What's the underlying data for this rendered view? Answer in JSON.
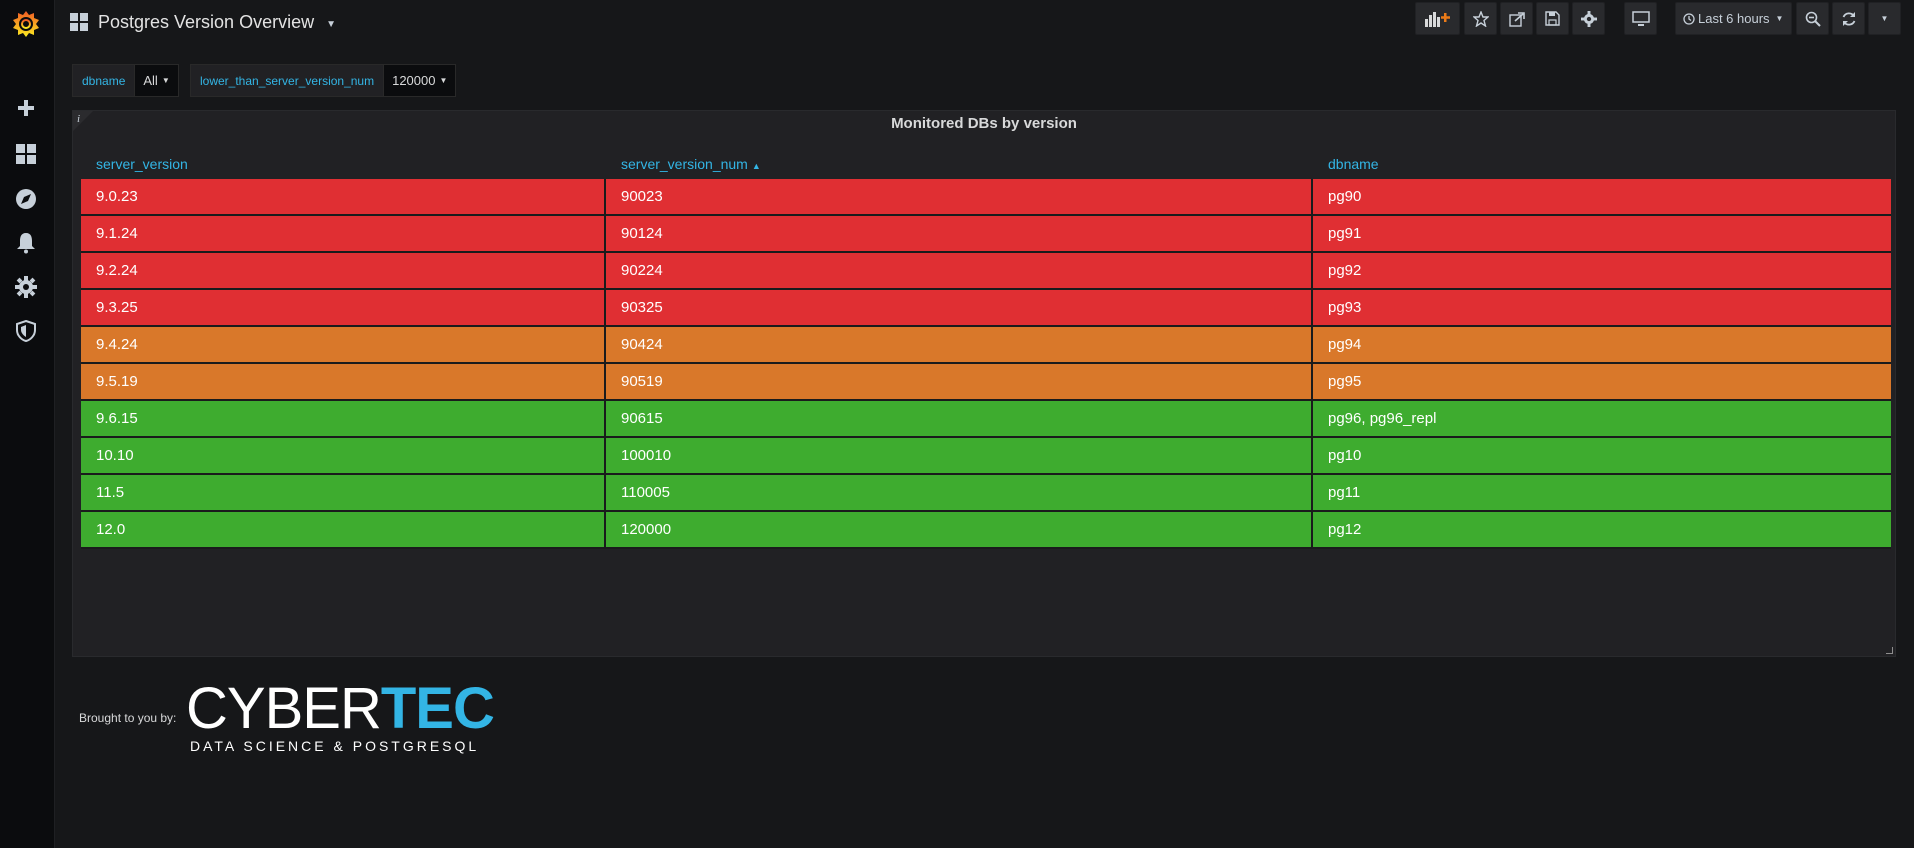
{
  "nav": {
    "title": "Postgres Version Overview",
    "time_range": "Last 6 hours"
  },
  "variables": [
    {
      "label": "dbname",
      "value": "All"
    },
    {
      "label": "lower_than_server_version_num",
      "value": "120000"
    }
  ],
  "panel": {
    "title": "Monitored DBs by version",
    "info": "i",
    "columns": [
      "server_version",
      "server_version_num",
      "dbname"
    ],
    "rows": [
      {
        "server_version": "9.0.23",
        "server_version_num": "90023",
        "dbname": "pg90",
        "status": "red"
      },
      {
        "server_version": "9.1.24",
        "server_version_num": "90124",
        "dbname": "pg91",
        "status": "red"
      },
      {
        "server_version": "9.2.24",
        "server_version_num": "90224",
        "dbname": "pg92",
        "status": "red"
      },
      {
        "server_version": "9.3.25",
        "server_version_num": "90325",
        "dbname": "pg93",
        "status": "red"
      },
      {
        "server_version": "9.4.24",
        "server_version_num": "90424",
        "dbname": "pg94",
        "status": "orange"
      },
      {
        "server_version": "9.5.19",
        "server_version_num": "90519",
        "dbname": "pg95",
        "status": "orange"
      },
      {
        "server_version": "9.6.15",
        "server_version_num": "90615",
        "dbname": "pg96, pg96_repl",
        "status": "green"
      },
      {
        "server_version": "10.10",
        "server_version_num": "100010",
        "dbname": "pg10",
        "status": "green"
      },
      {
        "server_version": "11.5",
        "server_version_num": "110005",
        "dbname": "pg11",
        "status": "green"
      },
      {
        "server_version": "12.0",
        "server_version_num": "120000",
        "dbname": "pg12",
        "status": "green"
      }
    ]
  },
  "colors": {
    "red": "#e02f33",
    "orange": "#d9782a",
    "green": "#3eac2f",
    "accent": "#33b5e5",
    "background": "#161719"
  },
  "footer": {
    "brought_by": "Brought to you by:",
    "logo_word_a": "CYBER",
    "logo_word_b": "TEC",
    "logo_sub": "DATA SCIENCE & POSTGRESQL"
  },
  "icons": [
    "grafana-logo-icon",
    "plus-icon",
    "dashboards-icon",
    "explore-compass-icon",
    "bell-icon",
    "gear-icon",
    "shield-icon",
    "add-panel-icon",
    "star-icon",
    "share-icon",
    "save-icon",
    "settings-icon",
    "tv-icon",
    "clock-icon",
    "zoom-out-icon",
    "refresh-icon",
    "chevron-down-icon"
  ]
}
